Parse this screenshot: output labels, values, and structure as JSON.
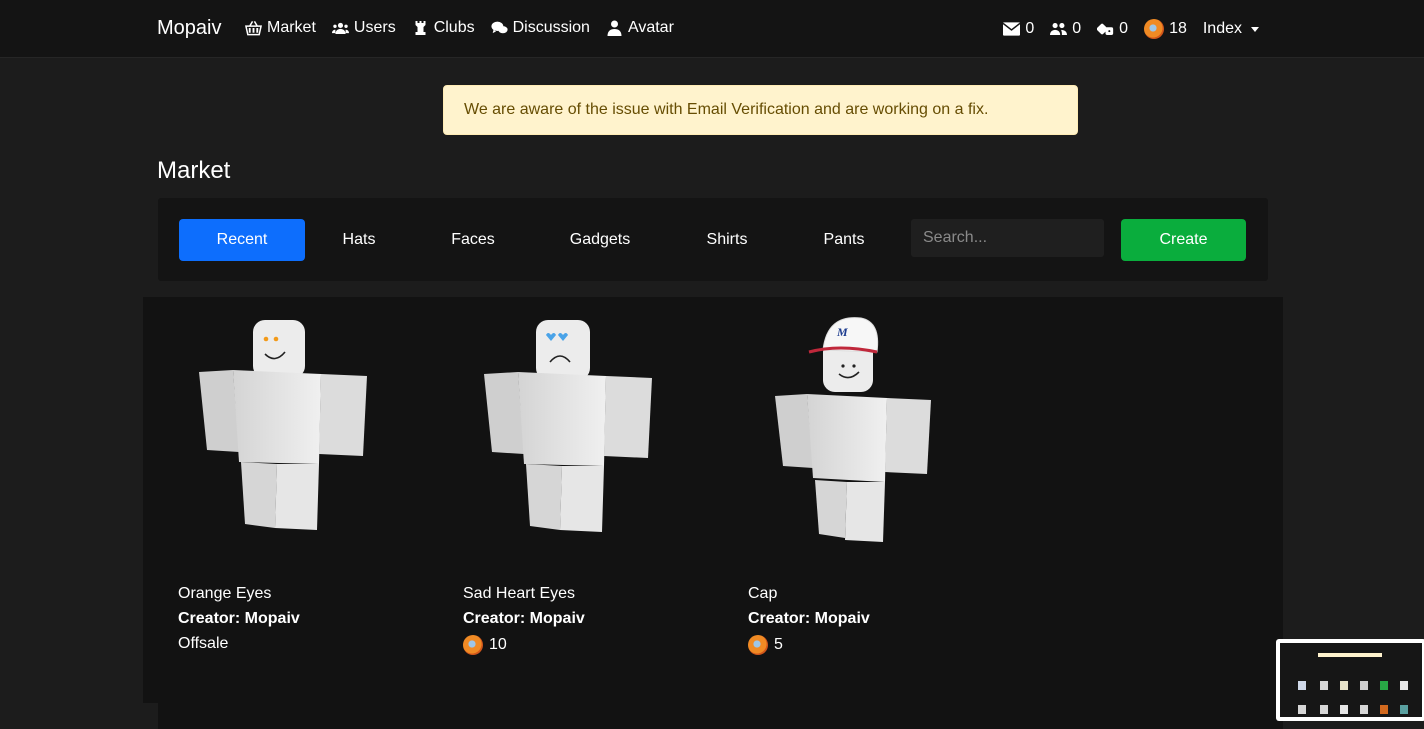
{
  "navbar": {
    "brand": "Mopaiv",
    "links": [
      {
        "label": "Market",
        "icon": "basket-icon"
      },
      {
        "label": "Users",
        "icon": "users-icon"
      },
      {
        "label": "Clubs",
        "icon": "chess-rook-icon"
      },
      {
        "label": "Discussion",
        "icon": "comments-icon"
      },
      {
        "label": "Avatar",
        "icon": "user-icon"
      }
    ],
    "stats": {
      "messages": "0",
      "friends": "0",
      "trades": "0",
      "currency": "18"
    },
    "index_label": "Index"
  },
  "alert": {
    "text": "We are aware of the issue with Email Verification and are working on a fix.",
    "bg_color": "#fff3cd",
    "text_color": "#664d03"
  },
  "page": {
    "title": "Market"
  },
  "tabs": [
    {
      "label": "Recent",
      "active": true
    },
    {
      "label": "Hats",
      "active": false
    },
    {
      "label": "Faces",
      "active": false
    },
    {
      "label": "Gadgets",
      "active": false
    },
    {
      "label": "Shirts",
      "active": false
    },
    {
      "label": "Pants",
      "active": false
    }
  ],
  "search": {
    "placeholder": "Search..."
  },
  "create_label": "Create",
  "colors": {
    "accent": "#0d6efd",
    "create": "#0aad3d",
    "background": "#1c1c1c",
    "panel": "#121212"
  },
  "items": [
    {
      "name": "Orange Eyes",
      "creator": "Creator: Mopaiv",
      "price": "Offsale",
      "has_coin": false,
      "face": "orange-eyes",
      "hat": false
    },
    {
      "name": "Sad Heart Eyes",
      "creator": "Creator: Mopaiv",
      "price": "10",
      "has_coin": true,
      "face": "sad-heart-eyes",
      "hat": false
    },
    {
      "name": "Cap",
      "creator": "Creator: Mopaiv",
      "price": "5",
      "has_coin": true,
      "face": "smile",
      "hat": true
    }
  ]
}
